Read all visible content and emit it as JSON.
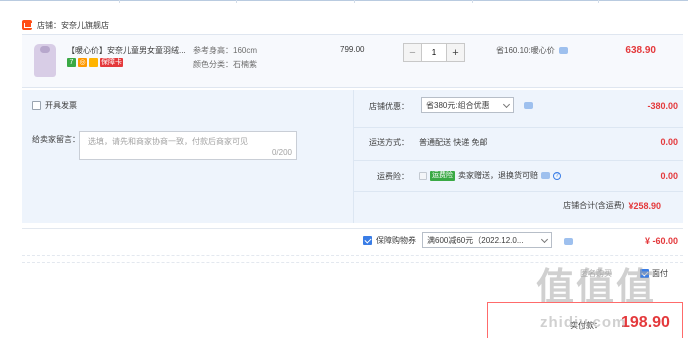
{
  "shop": {
    "label": "店铺：",
    "name": "安奈儿旗舰店"
  },
  "item": {
    "title": "【暖心价】安奈儿童男女童羽绒...",
    "badges": [
      {
        "text": "7",
        "color": "#3aa945"
      },
      {
        "text": "◎",
        "color": "#ff9900"
      },
      {
        "text": "▭",
        "color": "#ffb400"
      },
      {
        "text": "保障卡",
        "color": "#e4393c"
      }
    ],
    "spec_height_label": "参考身高：",
    "spec_height_value": "160cm",
    "spec_color_label": "颜色分类：",
    "spec_color_value": "石楠紫",
    "unit_price": "799.00",
    "quantity_minus": "−",
    "quantity": "1",
    "quantity_plus": "+",
    "savings": "省160.10:暖心价",
    "total": "638.90"
  },
  "options": {
    "invoice_label": "开具发票",
    "message_label": "给卖家留言：",
    "message_placeholder": "选填，请先和商家协商一致，付款后商家可见",
    "message_count": "0/200",
    "shop_discount_label": "店铺优惠：",
    "shop_discount_value": "省380元:组合优惠",
    "shop_discount_amount": "-380.00",
    "shipping_label": "运送方式：",
    "shipping_value": "普通配送 快递 免邮",
    "shipping_amount": "0.00",
    "insurance_label": "运费险：",
    "insurance_tag": "运费险",
    "insurance_value": "卖家赠送，退换货可赔",
    "insurance_amount": "0.00",
    "shop_total_label": "店铺合计(含运费)",
    "shop_total_value": "¥258.90"
  },
  "coupon": {
    "label": "保障购物券",
    "value": "满600减60元（2022.12.0...",
    "amount": "¥ -60.00"
  },
  "footer": {
    "partial_text_1": "匿名购买",
    "partial_text_2": "面付",
    "pay_label": "实付款：",
    "pay_amount": "198.90"
  },
  "watermark": {
    "text": "值 什么 值",
    "url": "zhidiy.com"
  },
  "colors": {
    "accent_red": "#e4393c",
    "panel_blue": "#eef4fc",
    "check_blue": "#3a7de6",
    "green_tag": "#3aa945"
  }
}
